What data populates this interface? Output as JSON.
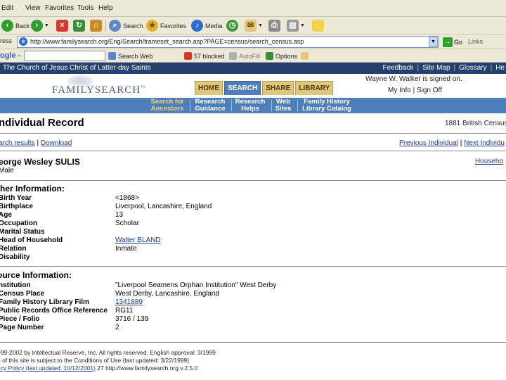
{
  "browser": {
    "menu": [
      "Edit",
      "View",
      "Favorites",
      "Tools",
      "Help"
    ],
    "toolbar": {
      "back": "Back",
      "search": "Search",
      "favorites": "Favorites",
      "media": "Media"
    },
    "address_label": "ress",
    "address_url": "http://www.familysearch.org/Eng/Search/frameset_search.asp?PAGE=census/search_census.asp",
    "go_label": "Go",
    "links_label": "Links",
    "google": {
      "logo": "ogle -",
      "search_web": "Search Web",
      "blocked": "57 blocked",
      "autofill": "AutoFill",
      "options": "Options"
    }
  },
  "site": {
    "org_bar": "The Church of Jesus Christ of Latter-day Saints",
    "top_links": [
      "Feedback",
      "Site Map",
      "Glossary",
      "He"
    ],
    "logo_text": "FAMILYSEARCH",
    "tabs": [
      "HOME",
      "SEARCH",
      "SHARE",
      "LIBRARY"
    ],
    "welcome": "Wayne W. Walker is signed on.",
    "account_links": [
      "My Info",
      "Sign Off"
    ],
    "subnav": [
      {
        "line1": "Search for",
        "line2": "Ancestors"
      },
      {
        "line1": "Research",
        "line2": "Guidance"
      },
      {
        "line1": "Research",
        "line2": "Helps"
      },
      {
        "line1": "Web",
        "line2": "Sites"
      },
      {
        "line1": "Family History",
        "line2": "Library Catalog"
      }
    ]
  },
  "record": {
    "title": "ndividual Record",
    "collection": "1881 British Census",
    "search_results_link": "arch results",
    "download_link": "Download",
    "previous_link": "Previous Individual",
    "next_link": "Next Individu",
    "name": "eorge Wesley SULIS",
    "sex": "Male",
    "household_link": "Househo",
    "other_heading": "ther Information:",
    "other_fields": [
      {
        "label": "Birth Year",
        "value": "<1868>"
      },
      {
        "label": "Birthplace",
        "value": "Liverpool, Lancashire, England"
      },
      {
        "label": "Age",
        "value": "13"
      },
      {
        "label": "Occupation",
        "value": "Scholar"
      },
      {
        "label": "Marital Status",
        "value": ""
      },
      {
        "label": "Head of Household",
        "value": "Walter BLAND",
        "is_link": true
      },
      {
        "label": "Relation",
        "value": "Inmate"
      },
      {
        "label": "Disability",
        "value": ""
      }
    ],
    "source_heading": "ource Information:",
    "source_fields": [
      {
        "label": "nstitution",
        "value": "\"Liverpool Seamens Orphan Institution\" West Derby"
      },
      {
        "label": "Census Place",
        "value": "West Derby, Lancashire, England"
      },
      {
        "label": "Family History Library Film",
        "value": "1341889",
        "is_link": true
      },
      {
        "label": "Public Records Office Reference",
        "value": "RG11"
      },
      {
        "label": "Piece / Folio",
        "value": "3716 / 139"
      },
      {
        "label": "Page Number",
        "value": "2"
      }
    ]
  },
  "footer": {
    "line1": "999-2002 by Intellectual Reserve, Inc. All rights reserved. English approval: 3/1999",
    "line2": "e of this site is subject to the Conditions of Use (last updated: 3/22/1999)",
    "line3": "acy Policy (last updated: 10/12/2001)",
    "line3_suffix": "27   http://www.familysearch.org   v.2.5.0"
  },
  "colors": {
    "org_bar": "#24406e",
    "nav_blue": "#4f7fb8",
    "tab_gold": "#dfc67a",
    "link": "#1a3d8c"
  }
}
